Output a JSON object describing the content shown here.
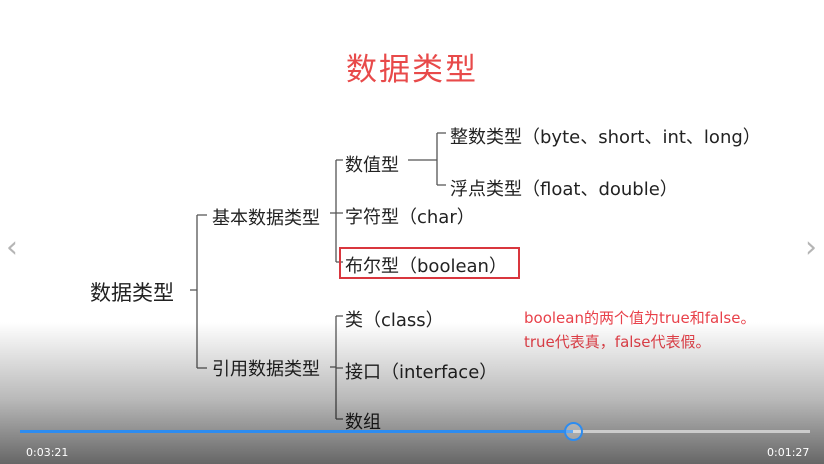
{
  "slide": {
    "title": "数据类型",
    "root": "数据类型",
    "primitive": {
      "label": "基本数据类型",
      "numeric": "数值型",
      "integer": "整数类型（byte、short、int、long）",
      "float": "浮点类型（float、double）",
      "char": "字符型（char）",
      "boolean": "布尔型（boolean）"
    },
    "reference": {
      "label": "引用数据类型",
      "class": "类（class）",
      "interface": "接口（interface）",
      "array": "数组"
    },
    "note": {
      "line1": "boolean的两个值为true和false。",
      "line2": "true代表真，false代表假。"
    }
  },
  "player": {
    "elapsed": "0:03:21",
    "remaining": "0:01:27",
    "progress": 0.7
  },
  "nav": {
    "prev_icon": "chevron-left-icon",
    "next_icon": "chevron-right-icon"
  },
  "colors": {
    "title": "#e84a4a",
    "highlight_box": "#d9363e",
    "progress": "#2d8cf0"
  }
}
